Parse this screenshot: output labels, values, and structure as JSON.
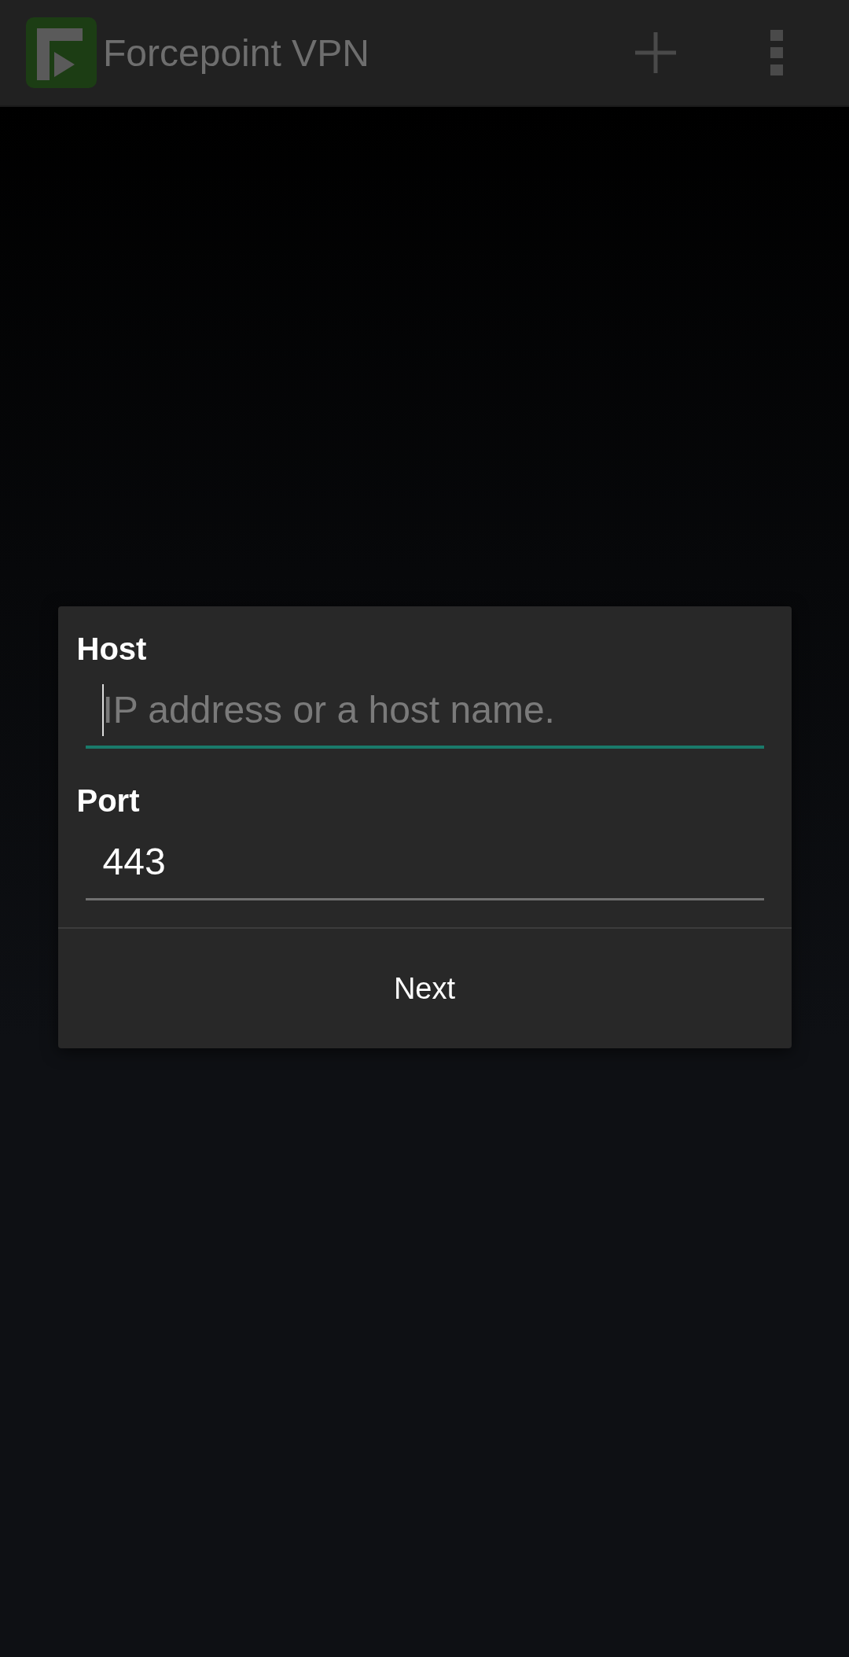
{
  "app_bar": {
    "title": "Forcepoint VPN"
  },
  "dialog": {
    "fields": [
      {
        "label": "Host",
        "placeholder": "IP address or a host name.",
        "focused": true
      },
      {
        "label": "Port",
        "value": "443",
        "focused": false
      }
    ],
    "button": "Next"
  }
}
